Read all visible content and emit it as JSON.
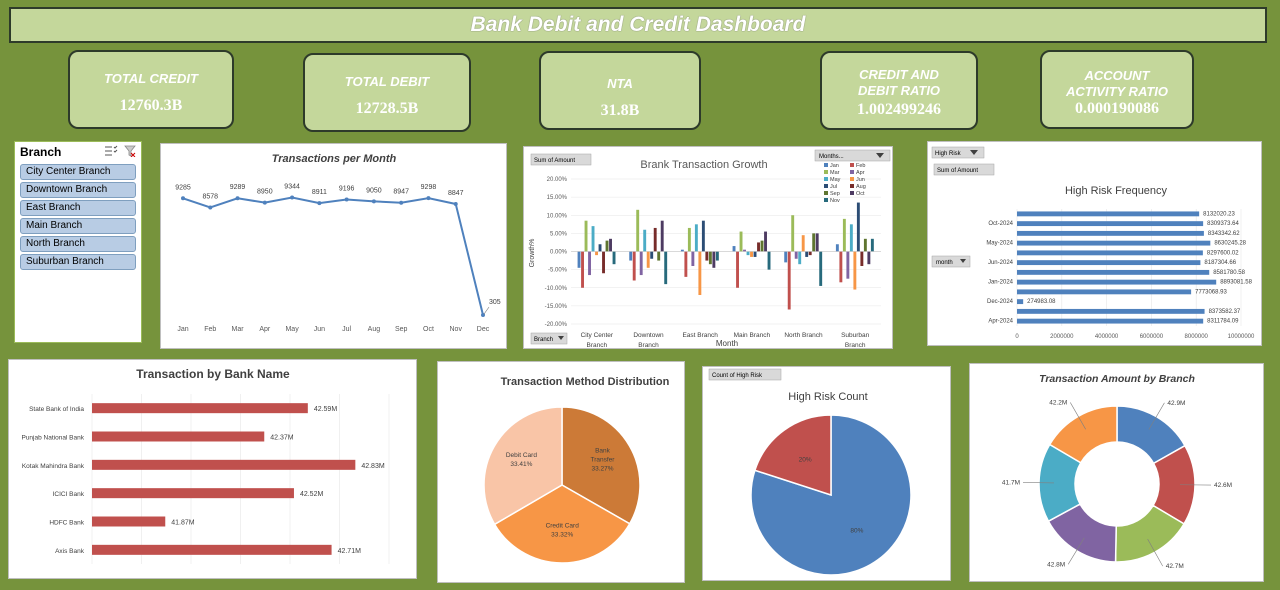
{
  "title": "Bank Debit and Credit Dashboard",
  "kpis": {
    "total_credit": {
      "label": "TOTAL CREDIT",
      "value": "12760.3B"
    },
    "total_debit": {
      "label": "TOTAL DEBIT",
      "value": "12728.5B"
    },
    "nta": {
      "label": "NTA",
      "value": "31.8B"
    },
    "ratio": {
      "label_line1": "CREDIT AND",
      "label_line2": "DEBIT RATIO",
      "value": "1.002499246"
    },
    "activity": {
      "label_line1": "ACCOUNT",
      "label_line2": "ACTIVITY RATIO",
      "value": "0.000190086"
    }
  },
  "slicer": {
    "header": "Branch",
    "items": [
      "City Center Branch",
      "Downtown Branch",
      "East Branch",
      "Main Branch",
      "North Branch",
      "Suburban Branch"
    ]
  },
  "colors": {
    "background": "#76933c",
    "kpi_fill": "#c4d79b",
    "line": "#4f81bd",
    "bar_red": "#c0504d",
    "bar_blue": "#4f81bd"
  },
  "chart_data": [
    {
      "id": "transactions_per_month",
      "type": "line",
      "title": "Transactions per Month",
      "categories": [
        "Jan",
        "Feb",
        "Mar",
        "Apr",
        "May",
        "Jun",
        "Jul",
        "Aug",
        "Sep",
        "Oct",
        "Nov",
        "Dec"
      ],
      "values": [
        9285,
        8578,
        9289,
        8950,
        9344,
        8911,
        9196,
        9050,
        8947,
        9298,
        8847,
        305
      ],
      "data_labels": [
        "9285",
        "8578",
        "9289",
        "8950",
        "9344",
        "8911",
        "9196",
        "9050",
        "8947",
        "9298",
        "8847",
        "305"
      ],
      "ylim": [
        0,
        10000
      ]
    },
    {
      "id": "bank_transaction_growth",
      "type": "bar",
      "title": "Brank Transaction Growth",
      "pivot_field": "Sum of Amount",
      "filter_field": "Months...",
      "axis_field": "Branch",
      "xlabel": "Month",
      "ylabel": "Growth%",
      "ylim": [
        -20,
        20
      ],
      "yticks": [
        "20.00%",
        "15.00%",
        "10.00%",
        "5.00%",
        "0.00%",
        "-5.00%",
        "-10.00%",
        "-15.00%",
        "-20.00%"
      ],
      "categories": [
        "City Center Branch",
        "Downtown Branch",
        "East Branch",
        "Main Branch",
        "North Branch",
        "Suburban Branch"
      ],
      "category_lines": [
        [
          "City Center",
          "Branch"
        ],
        [
          "Downtown",
          "Branch"
        ],
        [
          "East Branch",
          ""
        ],
        [
          "Main Branch",
          ""
        ],
        [
          "North Branch",
          ""
        ],
        [
          "Suburban",
          "Branch"
        ]
      ],
      "series": [
        {
          "name": "Jan",
          "color": "#4f81bd",
          "values": [
            -4.5,
            -2.5,
            0.5,
            1.5,
            -3.0,
            2.0
          ]
        },
        {
          "name": "Feb",
          "color": "#c0504d",
          "values": [
            -10.0,
            -8.0,
            -7.0,
            -10.0,
            -16.0,
            -8.5
          ]
        },
        {
          "name": "Mar",
          "color": "#9bbb59",
          "values": [
            8.5,
            11.5,
            6.5,
            5.5,
            10.0,
            9.0
          ]
        },
        {
          "name": "Apr",
          "color": "#8064a2",
          "values": [
            -6.5,
            -6.5,
            -4.0,
            0.5,
            -2.0,
            -7.5
          ]
        },
        {
          "name": "May",
          "color": "#4bacc6",
          "values": [
            7.0,
            6.0,
            7.5,
            -1.0,
            -3.5,
            7.5
          ]
        },
        {
          "name": "Jun",
          "color": "#f79646",
          "values": [
            -1.0,
            -4.5,
            -12.0,
            -1.5,
            4.5,
            -10.5
          ]
        },
        {
          "name": "Jul",
          "color": "#2c4d75",
          "values": [
            2.0,
            -2.0,
            8.5,
            -1.5,
            -1.5,
            13.5
          ]
        },
        {
          "name": "Aug",
          "color": "#772c2a",
          "values": [
            -6.0,
            6.5,
            -2.5,
            2.5,
            -1.0,
            -4.0
          ]
        },
        {
          "name": "Sep",
          "color": "#5f7530",
          "values": [
            3.0,
            -2.5,
            -3.5,
            3.0,
            5.0,
            3.5
          ]
        },
        {
          "name": "Oct",
          "color": "#4d3b62",
          "values": [
            3.5,
            8.5,
            -4.5,
            5.5,
            5.0,
            -3.5
          ]
        },
        {
          "name": "Nov",
          "color": "#276a7c",
          "values": [
            -3.5,
            -9.0,
            -2.5,
            -5.0,
            -9.5,
            3.5
          ]
        }
      ]
    },
    {
      "id": "high_risk_frequency",
      "type": "bar",
      "orientation": "horizontal",
      "title": "High Risk Frequency",
      "filter_field": "High Risk",
      "pivot_field": "Sum of Amount",
      "axis_field": "month",
      "xlim": [
        0,
        10000000
      ],
      "xticks": [
        "0",
        "2000000",
        "4000000",
        "6000000",
        "8000000",
        "10000000"
      ],
      "categories_top_to_bottom": [
        "",
        "Oct-2024",
        "",
        "May-2024",
        "",
        "Jun-2024",
        "",
        "Jan-2024",
        "",
        "Dec-2024",
        "",
        "Apr-2024"
      ],
      "values_top_to_bottom": [
        8132020.23,
        8309373.64,
        8343342.62,
        8630245.28,
        8297600.02,
        8187304.66,
        8581780.58,
        8893081.58,
        7773068.93,
        274983.08,
        8373582.37,
        8311784.09
      ],
      "data_labels": [
        "8132020.23",
        "8309373.64",
        "8343342.62",
        "8630245.28",
        "8297600.02",
        "8187304.66",
        "8581780.58",
        "8893081.58",
        "7773068.93",
        "274983.08",
        "8373582.37",
        "8311784.09"
      ]
    },
    {
      "id": "transaction_by_bank",
      "type": "bar",
      "orientation": "horizontal",
      "title": "Transaction by Bank Name",
      "categories": [
        "State Bank of India",
        "Punjab National Bank",
        "Kotak Mahindra Bank",
        "ICICI Bank",
        "HDFC Bank",
        "Axis Bank"
      ],
      "values": [
        42.59,
        42.37,
        42.83,
        42.52,
        41.87,
        42.71
      ],
      "data_labels": [
        "42.59M",
        "42.37M",
        "42.83M",
        "42.52M",
        "41.87M",
        "42.71M"
      ],
      "xlim": [
        41.5,
        43.0
      ]
    },
    {
      "id": "transaction_method_distribution",
      "type": "pie",
      "title": "Transaction Method Distribution",
      "slices": [
        {
          "label_lines": [
            "Bank",
            "Transfer",
            "33.27%"
          ],
          "value": 33.27,
          "color": "#cc7a37"
        },
        {
          "label_lines": [
            "Credit Card",
            "33.32%"
          ],
          "value": 33.32,
          "color": "#f79646"
        },
        {
          "label_lines": [
            "Debit Card",
            "33.41%"
          ],
          "value": 33.41,
          "color": "#f9c5a7"
        }
      ]
    },
    {
      "id": "high_risk_count",
      "type": "pie",
      "title": "High Risk Count",
      "pivot_field": "Count of High Risk",
      "slices": [
        {
          "label": "80%",
          "value": 80,
          "color": "#4f81bd"
        },
        {
          "label": "20%",
          "value": 20,
          "color": "#c0504d"
        }
      ]
    },
    {
      "id": "transaction_amount_by_branch",
      "type": "donut",
      "title": "Transaction Amount by Branch",
      "slices": [
        {
          "label": "42.9M",
          "value": 42.9,
          "color": "#4f81bd"
        },
        {
          "label": "42.6M",
          "value": 42.6,
          "color": "#c0504d"
        },
        {
          "label": "42.7M",
          "value": 42.7,
          "color": "#9bbb59"
        },
        {
          "label": "42.8M",
          "value": 42.8,
          "color": "#8064a2"
        },
        {
          "label": "41.7M",
          "value": 41.7,
          "color": "#4bacc6"
        },
        {
          "label": "42.2M",
          "value": 42.2,
          "color": "#f79646"
        }
      ]
    }
  ]
}
